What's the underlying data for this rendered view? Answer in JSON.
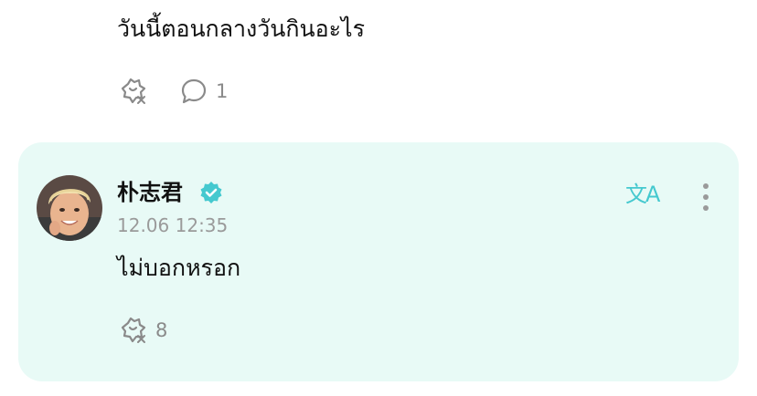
{
  "previous_comment": {
    "text": "วันนี้ตอนกลางวันกินอะไร",
    "reaction_icon": "reaction-add-icon",
    "comment_icon": "comment-bubble-icon",
    "comment_count": "1"
  },
  "reply": {
    "author": "朴志君",
    "verified_icon": "verified-badge-icon",
    "timestamp": "12.06 12:35",
    "text": "ไม่บอกหรอก",
    "translate_icon": "translate-icon",
    "translate_label": "文A",
    "more_icon": "more-vertical-icon",
    "reaction_count": "8"
  },
  "colors": {
    "accent": "#45c9cf",
    "card_background": "#e8faf6",
    "muted_text": "#9a9a9a",
    "icon_gray": "#8a8a8a"
  }
}
